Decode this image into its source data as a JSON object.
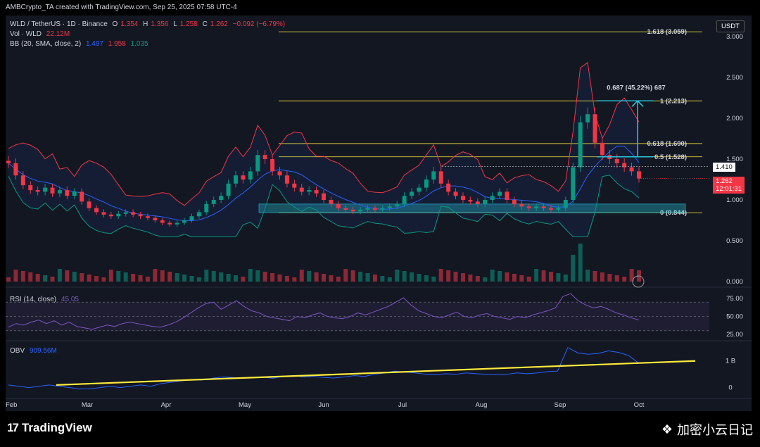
{
  "header": {
    "credit": "AMBCrypto_TA created with TradingView.com, Sep 25, 2025 07:58 UTC-4"
  },
  "legend": {
    "symbol": "WLD / TetherUS · 1D · Binance",
    "o_label": "O",
    "o": "1.354",
    "h_label": "H",
    "h": "1.356",
    "l_label": "L",
    "l": "1.258",
    "c_label": "C",
    "c": "1.262",
    "change": "−0.092 (−6.79%)",
    "vol_label": "Vol · WLD",
    "vol": "22.12M",
    "bb_label": "BB (20, SMA, close, 2)",
    "bb_basis": "1.497",
    "bb_upper": "1.958",
    "bb_lower": "1.035",
    "rsi_label": "RSI (14, close)",
    "rsi": "45.05",
    "obv_label": "OBV",
    "obv": "909.56M"
  },
  "currency_button": "USDT",
  "price_tags": {
    "last_close": "1.262",
    "countdown": "12:01:31",
    "dotted_level": "1.410"
  },
  "measure_label": "0.687 (45.22%) 687",
  "footer": {
    "brand": "TradingView",
    "watermark": "加密小云日记"
  },
  "colors": {
    "up": "#089981",
    "down": "#f23645",
    "bb_basis": "#2962ff",
    "bb_band": "#f23645",
    "bb_lower": "#089981",
    "fib": "#ffeb3b",
    "rsi": "#7e57c2",
    "obv": "#2962ff",
    "zone": "#26c6da"
  },
  "chart_data": [
    {
      "type": "candlestick",
      "title": "WLD / TetherUS · 1D · Binance",
      "x_ticks": [
        "Feb",
        "Mar",
        "Apr",
        "May",
        "Jun",
        "Jul",
        "Aug",
        "Sep",
        "Oct"
      ],
      "y_ticks": [
        "3.000",
        "2.500",
        "2.000",
        "1.500",
        "1.000",
        "0.500",
        "0.000"
      ],
      "ylim": [
        0,
        3.1
      ],
      "fib_levels": [
        {
          "label": "1.618 (3.059)",
          "value": 3.059
        },
        {
          "label": "1 (2.213)",
          "value": 2.213
        },
        {
          "label": "0.618 (1.690)",
          "value": 1.69
        },
        {
          "label": "0.5 (1.528)",
          "value": 1.528
        },
        {
          "label": "0 (0.844)",
          "value": 0.844
        }
      ],
      "support_zone": [
        0.844,
        0.95
      ],
      "close_series": [
        1.45,
        1.3,
        1.18,
        1.12,
        1.1,
        1.15,
        1.08,
        1.12,
        1.05,
        1.1,
        0.98,
        0.9,
        0.85,
        0.82,
        0.8,
        0.83,
        0.85,
        0.82,
        0.8,
        0.78,
        0.75,
        0.72,
        0.7,
        0.72,
        0.75,
        0.8,
        0.85,
        0.95,
        1.0,
        1.05,
        1.2,
        1.3,
        1.25,
        1.35,
        1.55,
        1.5,
        1.35,
        1.3,
        1.2,
        1.15,
        1.1,
        1.12,
        1.08,
        1.0,
        0.95,
        0.9,
        0.88,
        0.86,
        0.88,
        0.9,
        0.88,
        0.9,
        0.92,
        0.95,
        1.05,
        1.1,
        1.15,
        1.25,
        1.35,
        1.2,
        1.1,
        1.05,
        1.0,
        0.98,
        0.95,
        1.0,
        1.05,
        1.1,
        1.0,
        0.95,
        0.92,
        0.9,
        0.92,
        0.9,
        0.88,
        0.9,
        1.0,
        1.4,
        1.95,
        2.05,
        1.7,
        1.55,
        1.5,
        1.45,
        1.4,
        1.35,
        1.262
      ]
    },
    {
      "type": "line",
      "title": "RSI (14, close)",
      "y_ticks": [
        "75.00",
        "50.00",
        "25.00"
      ],
      "ylim": [
        20,
        85
      ],
      "band": [
        30,
        70
      ],
      "values": [
        35,
        40,
        38,
        42,
        45,
        40,
        44,
        38,
        42,
        36,
        34,
        32,
        35,
        38,
        36,
        40,
        42,
        40,
        38,
        36,
        35,
        38,
        42,
        48,
        55,
        62,
        68,
        70,
        60,
        66,
        72,
        64,
        58,
        55,
        50,
        48,
        46,
        44,
        50,
        48,
        52,
        55,
        50,
        48,
        47,
        50,
        55,
        52,
        56,
        60,
        64,
        70,
        76,
        66,
        58,
        54,
        50,
        48,
        52,
        56,
        50,
        48,
        52,
        54,
        50,
        48,
        46,
        50,
        48,
        52,
        55,
        58,
        62,
        78,
        82,
        72,
        66,
        62,
        64,
        60,
        55,
        52,
        48,
        45.05
      ]
    },
    {
      "type": "line",
      "title": "OBV",
      "y_ticks": [
        "1 B",
        "0"
      ],
      "ylim": [
        -0.3,
        1.6
      ],
      "values": [
        0.1,
        0.05,
        0.0,
        0.05,
        0.1,
        0.05,
        0.0,
        -0.05,
        -0.05,
        0.0,
        0.05,
        0.0,
        0.05,
        0.1,
        0.05,
        0.15,
        0.2,
        0.25,
        0.3,
        0.28,
        0.35,
        0.4,
        0.38,
        0.35,
        0.38,
        0.4,
        0.35,
        0.42,
        0.45,
        0.4,
        0.42,
        0.38,
        0.36,
        0.4,
        0.45,
        0.42,
        0.5,
        0.55,
        0.62,
        0.58,
        0.55,
        0.5,
        0.48,
        0.52,
        0.5,
        0.55,
        0.52,
        0.5,
        0.48,
        0.5,
        0.55,
        0.52,
        0.55,
        0.6,
        0.62,
        1.5,
        1.3,
        1.25,
        1.28,
        1.38,
        1.32,
        1.2,
        0.90956
      ],
      "trendline": [
        0.1,
        1.0
      ]
    }
  ]
}
